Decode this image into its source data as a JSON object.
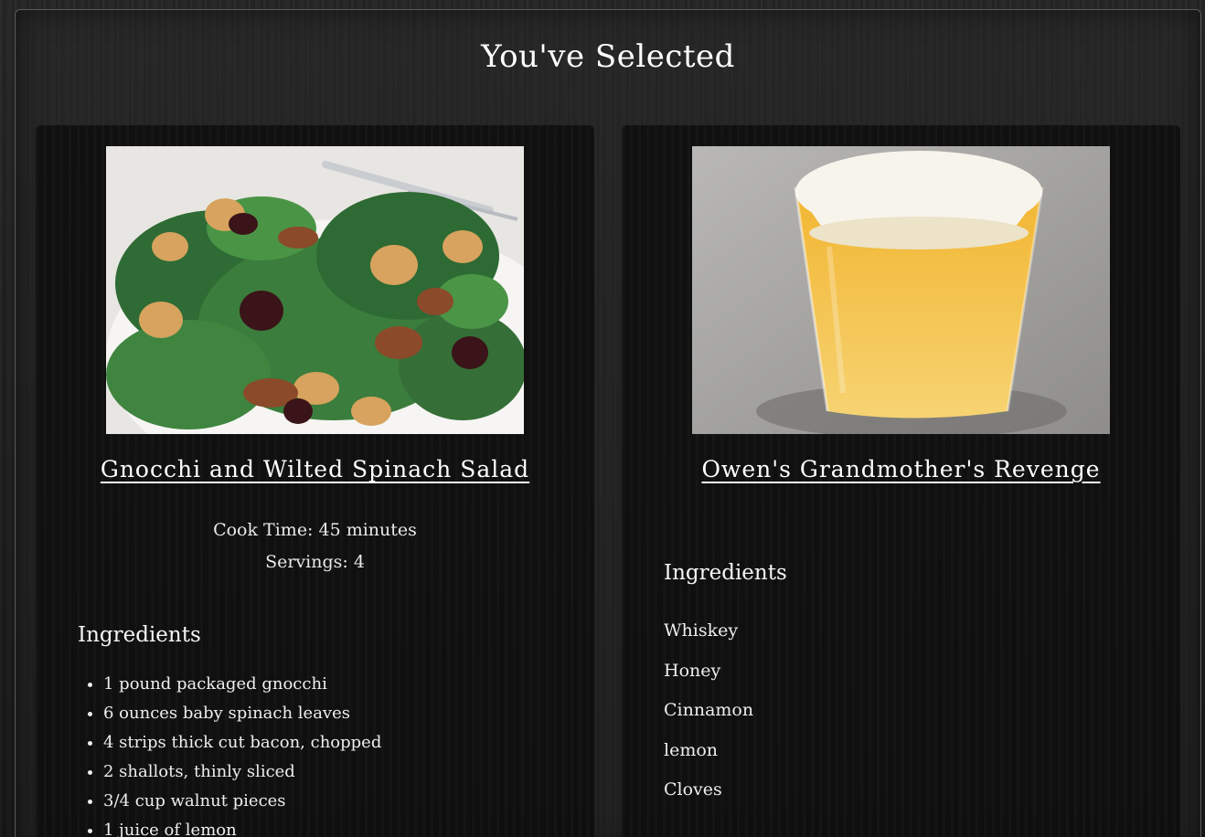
{
  "page": {
    "title": "You've Selected"
  },
  "recipes": [
    {
      "name": "Gnocchi and Wilted Spinach Salad",
      "image_icon": "spinach-salad-photo",
      "cook_time": "Cook Time: 45 minutes",
      "servings": "Servings: 4",
      "ingredients_heading": "Ingredients",
      "ingredients": [
        "1 pound packaged gnocchi",
        "6 ounces baby spinach leaves",
        "4 strips thick cut bacon, chopped",
        "2 shallots, thinly sliced",
        "3/4 cup walnut pieces",
        "1 juice of lemon"
      ]
    },
    {
      "name": "Owen's Grandmother's Revenge",
      "image_icon": "cocktail-glass-photo",
      "ingredients_heading": "Ingredients",
      "ingredients": [
        "Whiskey",
        "Honey",
        "Cinnamon",
        "lemon",
        "Cloves"
      ]
    }
  ],
  "colors": {
    "background": "#1a1a1a",
    "card": "#0a0a0a",
    "text": "#f2f2f2"
  }
}
